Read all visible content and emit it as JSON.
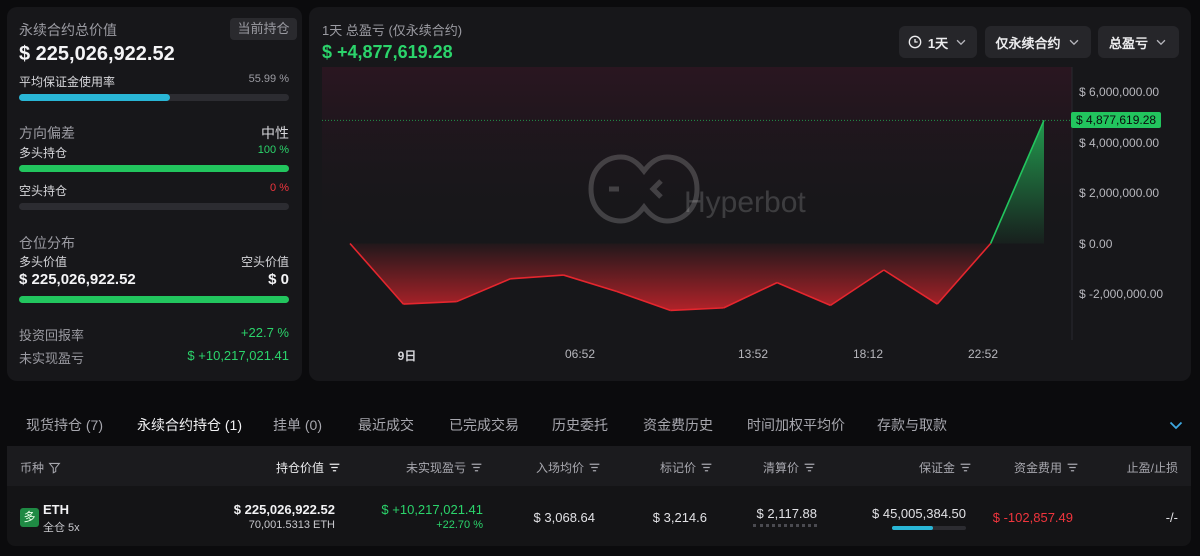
{
  "summary": {
    "title": "永续合约总价值",
    "tag": "当前持仓",
    "total_value": "$ 225,026,922.52",
    "margin_label": "平均保证金使用率",
    "margin_pct_text": "55.99 %",
    "margin_fraction": 0.5599,
    "bias_label": "方向偏差",
    "bias_value": "中性",
    "long_label": "多头持仓",
    "long_pct_text": "100 %",
    "long_fraction": 1.0,
    "short_label": "空头持仓",
    "short_pct_text": "0 %",
    "short_fraction": 0.0,
    "dist_label": "仓位分布",
    "long_value_label": "多头价值",
    "short_value_label": "空头价值",
    "long_value": "$ 225,026,922.52",
    "short_value": "$ 0",
    "roi_label": "投资回报率",
    "roi_value": "+22.7 %",
    "unrealized_label": "未实现盈亏",
    "unrealized_value": "$ +10,217,021.41"
  },
  "chart_header": {
    "title": "1天 总盈亏 (仅永续合约)",
    "value": "$ +4,877,619.28",
    "range_label": "1天",
    "scope_label": "仅永续合约",
    "metric_label": "总盈亏",
    "watermark": "Hyperbot"
  },
  "chart_data": {
    "type": "area",
    "x_ticks": [
      "9日",
      "06:52",
      "13:52",
      "18:12",
      "22:52"
    ],
    "y_ticks": [
      "$ 6,000,000.00",
      "$ 4,000,000.00",
      "$ 2,000,000.00",
      "$ 0.00",
      "$ -2,000,000.00"
    ],
    "ylim": [
      -3000000,
      7000000
    ],
    "y_tick_values": [
      6000000,
      4000000,
      2000000,
      0,
      -2000000
    ],
    "current_label": "$ 4,877,619.28",
    "current_value": 4877619.28,
    "values": [
      0,
      -2400000,
      -2300000,
      -1400000,
      -1250000,
      -1900000,
      -2650000,
      -2550000,
      -1550000,
      -2450000,
      -1050000,
      -2400000,
      0,
      4877619.28
    ],
    "grid": false,
    "colors": {
      "positive": "#22c55e",
      "negative": "#e5262e"
    }
  },
  "tabs": [
    {
      "label": "现货持仓 (7)"
    },
    {
      "label": "永续合约持仓 (1)"
    },
    {
      "label": "挂单 (0)"
    },
    {
      "label": "最近成交"
    },
    {
      "label": "已完成交易"
    },
    {
      "label": "历史委托"
    },
    {
      "label": "资金费历史"
    },
    {
      "label": "时间加权平均价"
    },
    {
      "label": "存款与取款"
    }
  ],
  "table": {
    "headers": [
      "币种",
      "持仓价值",
      "未实现盈亏",
      "入场均价",
      "标记价",
      "清算价",
      "保证金",
      "资金费用",
      "止盈/止损"
    ],
    "row": {
      "side_badge": "多",
      "coin": "ETH",
      "mode": "全仓 5x",
      "position_value": "$ 225,026,922.52",
      "position_size": "70,001.5313 ETH",
      "unrealized": "$ +10,217,021.41",
      "unrealized_pct": "+22.70 %",
      "entry_price": "$ 3,068.64",
      "mark_price": "$ 3,214.6",
      "liq_price": "$ 2,117.88",
      "margin": "$ 45,005,384.50",
      "margin_fraction": 0.5599,
      "funding": "$ -102,857.49",
      "tpsl": "-/-"
    }
  },
  "colors": {
    "accent_cyan": "#29b6d6",
    "green": "#2bd46b",
    "red": "#f0353d",
    "panel": "#17171a"
  }
}
